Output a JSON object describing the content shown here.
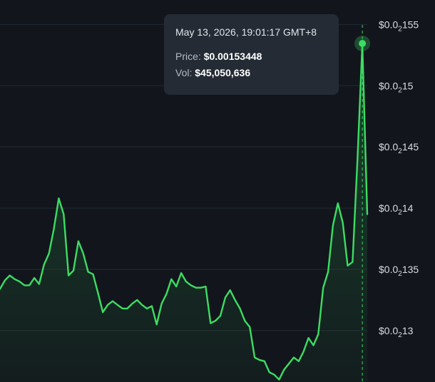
{
  "chart_data": {
    "type": "area",
    "x_unit": "relative time (sample index)",
    "y_ticks": [
      {
        "value": 0.00155,
        "prefix": "$0.0",
        "sub": "2",
        "suffix": "155"
      },
      {
        "value": 0.0015,
        "prefix": "$0.0",
        "sub": "2",
        "suffix": "15"
      },
      {
        "value": 0.00145,
        "prefix": "$0.0",
        "sub": "2",
        "suffix": "145"
      },
      {
        "value": 0.0014,
        "prefix": "$0.0",
        "sub": "2",
        "suffix": "14"
      },
      {
        "value": 0.00135,
        "prefix": "$0.0",
        "sub": "2",
        "suffix": "135"
      },
      {
        "value": 0.0013,
        "prefix": "$0.0",
        "sub": "2",
        "suffix": "13"
      }
    ],
    "ylim": [
      0.001258,
      0.00157
    ],
    "grid": true,
    "line_color": "#3ddc63",
    "values": [
      0.001334,
      0.001341,
      0.001345,
      0.001342,
      0.00134,
      0.001337,
      0.001337,
      0.001343,
      0.001338,
      0.001354,
      0.001363,
      0.001383,
      0.001408,
      0.001395,
      0.001345,
      0.001349,
      0.001373,
      0.001363,
      0.001348,
      0.001346,
      0.001331,
      0.001315,
      0.001321,
      0.001324,
      0.001321,
      0.001318,
      0.001318,
      0.001322,
      0.001325,
      0.001321,
      0.001318,
      0.00132,
      0.001305,
      0.001322,
      0.00133,
      0.001342,
      0.001336,
      0.001347,
      0.00134,
      0.001337,
      0.001335,
      0.001335,
      0.001336,
      0.001306,
      0.001308,
      0.001312,
      0.001327,
      0.001333,
      0.001325,
      0.001318,
      0.001308,
      0.001303,
      0.001278,
      0.001276,
      0.001275,
      0.001266,
      0.001264,
      0.00126,
      0.001268,
      0.001273,
      0.001278,
      0.001275,
      0.001283,
      0.001294,
      0.001288,
      0.001297,
      0.001335,
      0.001348,
      0.001386,
      0.001404,
      0.001388,
      0.001353,
      0.001356,
      0.00144,
      0.001534,
      0.001395
    ],
    "highlight": {
      "index": 74,
      "value": 0.00153448
    }
  },
  "tooltip": {
    "date": "May 13, 2026, 19:01:17 GMT+8",
    "price_label": "Price:",
    "price_value": "$0.00153448",
    "vol_label": "Vol:",
    "vol_value": "$45,050,636"
  }
}
